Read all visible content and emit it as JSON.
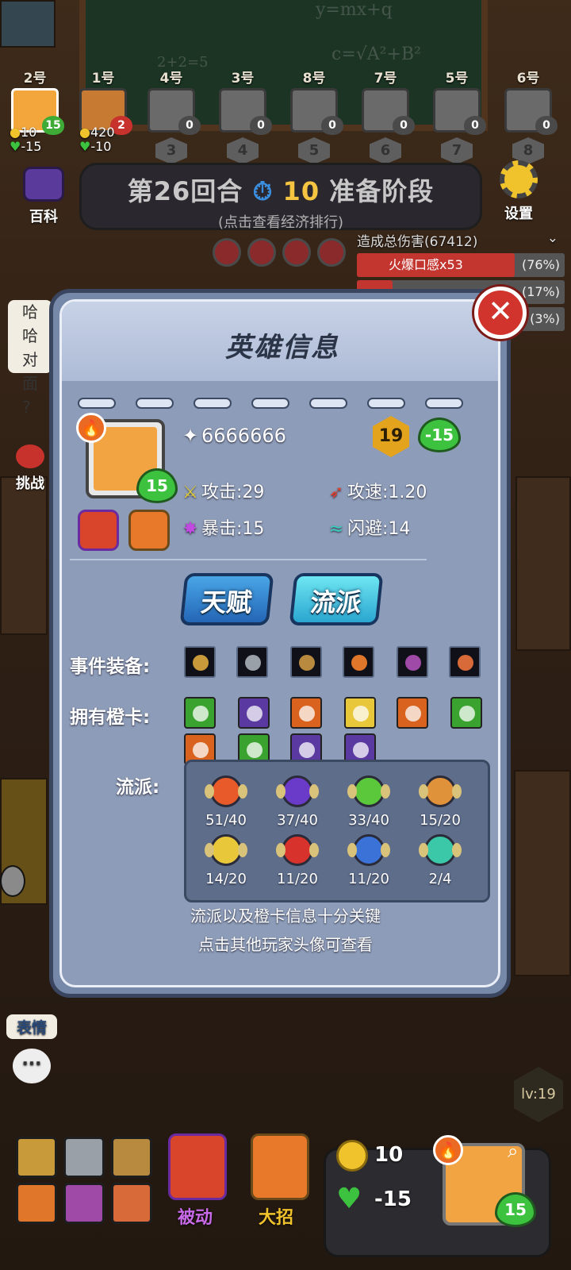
{
  "top": {
    "players": [
      {
        "num": "2号",
        "hp": "15",
        "rank": ""
      },
      {
        "num": "1号",
        "hp": "2",
        "rank": ""
      },
      {
        "num": "4号",
        "hp": "0",
        "rank": "3"
      },
      {
        "num": "3号",
        "hp": "0",
        "rank": "4"
      },
      {
        "num": "8号",
        "hp": "0",
        "rank": "5"
      },
      {
        "num": "7号",
        "hp": "0",
        "rank": "6"
      },
      {
        "num": "5号",
        "hp": "0",
        "rank": "7"
      },
      {
        "num": "6号",
        "hp": "0",
        "rank": "8"
      }
    ],
    "p1_gold": "10",
    "p1_delta": "-15",
    "p2_gold": "420",
    "p2_delta": "-10"
  },
  "round": {
    "round_label": "第26回合",
    "timer": "10",
    "phase": "准备阶段",
    "sub": "(点击查看经济排行)"
  },
  "buttons": {
    "encyclopedia": "百科",
    "settings": "设置",
    "challenge": "挑战",
    "emote": "表情",
    "passive": "被动",
    "ultimate": "大招"
  },
  "damage": {
    "header": "造成总伤害(67412)",
    "rows": [
      {
        "name": "火爆口感x53",
        "pct": "(76%)",
        "value": 76
      },
      {
        "name": "",
        "pct": "(17%)",
        "value": 17
      },
      {
        "name": "",
        "pct": "(3%)",
        "value": 3
      }
    ]
  },
  "chat": {
    "line1": "哈哈",
    "line2": "对面",
    "line3": "?"
  },
  "modal": {
    "title": "英雄信息",
    "power": "6666666",
    "level_badge": "19",
    "hp_delta": "-15",
    "avatar_hp": "15",
    "attack": "攻击:29",
    "attack_speed": "攻速:1.20",
    "crit": "暴击:15",
    "dodge": "闪避:14",
    "tab_talent": "天赋",
    "tab_genre": "流派",
    "equip_label": "事件装备:",
    "cards_label": "拥有橙卡:",
    "genre_label": "流派:",
    "genres": [
      "51/40",
      "37/40",
      "33/40",
      "15/20",
      "14/20",
      "11/20",
      "11/20",
      "2/4"
    ],
    "hint1": "流派以及橙卡信息十分关键",
    "hint2": "点击其他玩家头像可查看"
  },
  "tray": {
    "gold": "10",
    "hp": "-15",
    "avatar_hp": "15",
    "level": "lv:19"
  },
  "colors": {
    "accent_red": "#d0342c",
    "heart_green": "#3dc23f",
    "gold": "#e3a31d",
    "modal_bg": "#8d9cb8"
  }
}
